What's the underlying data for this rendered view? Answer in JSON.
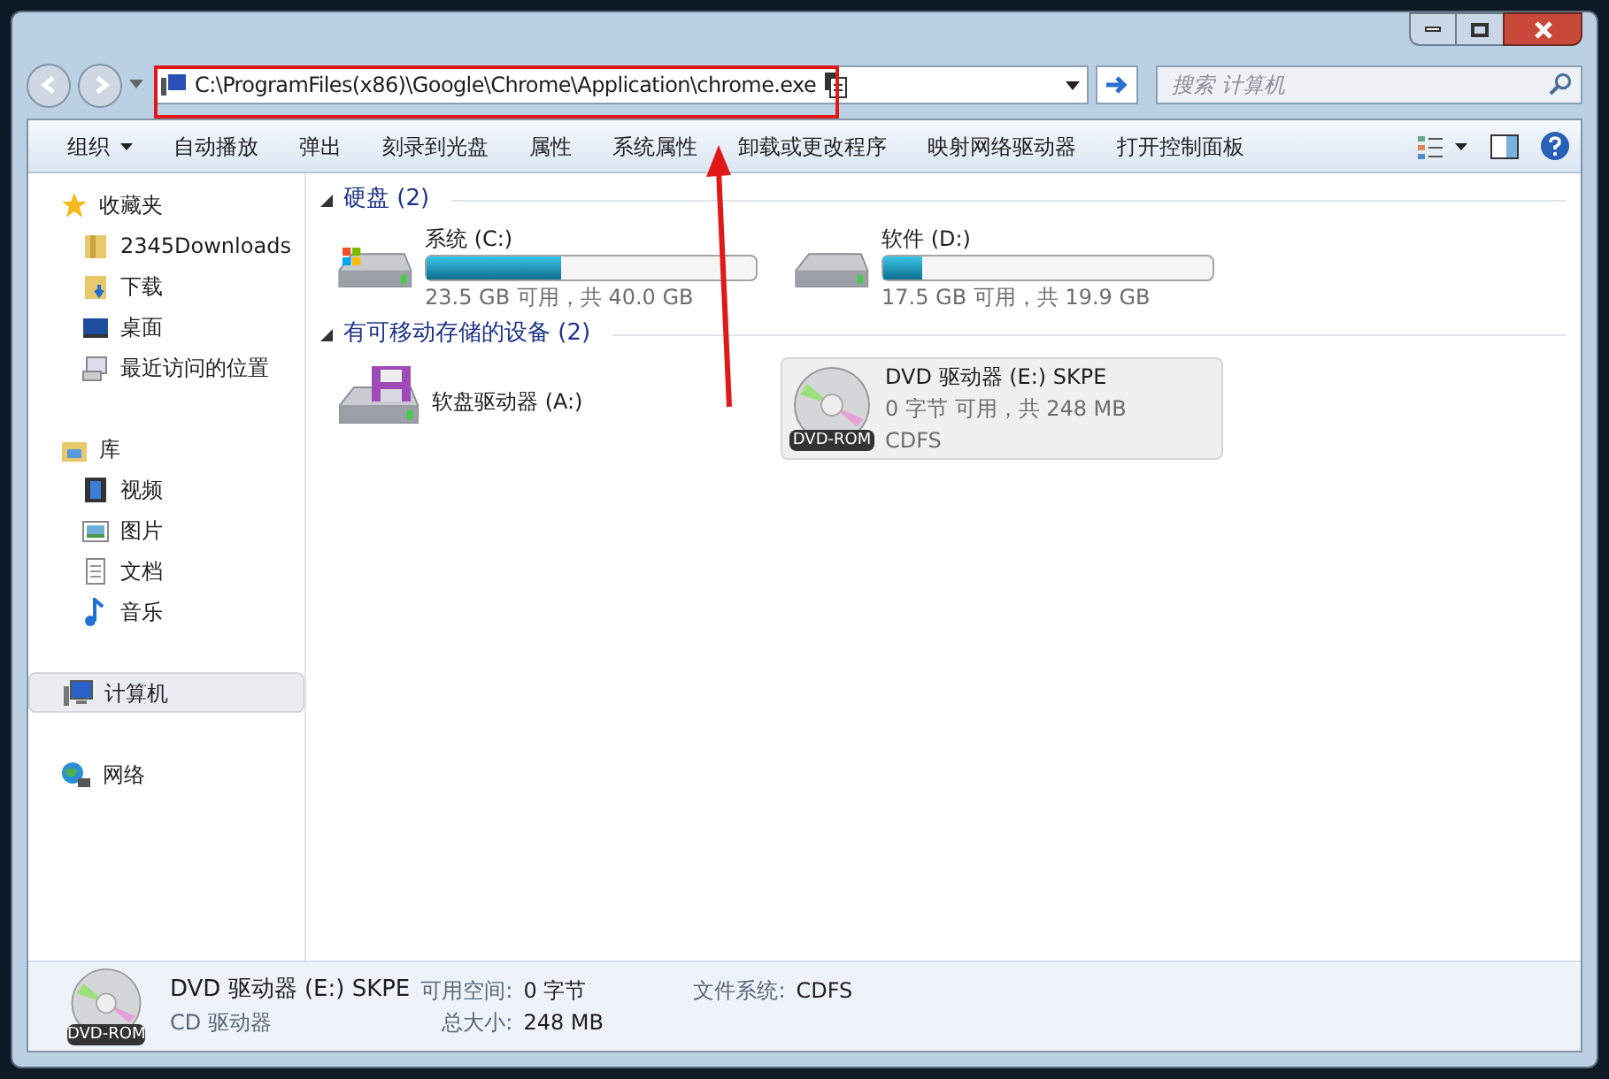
{
  "window": {
    "address": "C:\\ProgramFiles(x86)\\Google\\Chrome\\Application\\chrome.exe",
    "search": {
      "placeholder": "搜索 计算机"
    }
  },
  "toolbar": [
    {
      "label": "组织",
      "dropdown": true
    },
    {
      "label": "自动播放",
      "dropdown": false
    },
    {
      "label": "弹出",
      "dropdown": false
    },
    {
      "label": "刻录到光盘",
      "dropdown": false
    },
    {
      "label": "属性",
      "dropdown": false
    },
    {
      "label": "系统属性",
      "dropdown": false
    },
    {
      "label": "卸载或更改程序",
      "dropdown": false
    },
    {
      "label": "映射网络驱动器",
      "dropdown": false
    },
    {
      "label": "打开控制面板",
      "dropdown": false
    }
  ],
  "sidebar": {
    "items": [
      {
        "label": "收藏夹",
        "selected": false,
        "children": [
          {
            "label": "2345Downloads",
            "selected": false
          },
          {
            "label": "下载",
            "selected": false
          },
          {
            "label": "桌面",
            "selected": false
          },
          {
            "label": "最近访问的位置",
            "selected": false
          }
        ]
      },
      {
        "label": "库",
        "selected": false,
        "children": [
          {
            "label": "视频",
            "selected": false
          },
          {
            "label": "图片",
            "selected": false
          },
          {
            "label": "文档",
            "selected": false
          },
          {
            "label": "音乐",
            "selected": false
          }
        ]
      },
      {
        "label": "计算机",
        "selected": true
      },
      {
        "label": "网络",
        "selected": false
      }
    ]
  },
  "groups": [
    {
      "title": "硬盘 (2)",
      "drives": [
        {
          "kind": "hdd",
          "name": "系统 (C:)",
          "level": 0.41,
          "info": "23.5 GB 可用，共 40.0 GB",
          "windows": true,
          "selected": false
        },
        {
          "kind": "hdd",
          "name": "软件 (D:)",
          "level": 0.12,
          "info": "17.5 GB 可用，共 19.9 GB",
          "windows": false,
          "selected": false
        }
      ]
    },
    {
      "title": "有可移动存储的设备 (2)",
      "drives": [
        {
          "kind": "floppy",
          "name": "软盘驱动器 (A:)",
          "selected": false
        },
        {
          "kind": "dvd",
          "name": "DVD 驱动器 (E:) SKPE",
          "info": "0 字节 可用，共 248 MB",
          "fs": "CDFS",
          "disc_label": "DVD-ROM",
          "selected": true
        }
      ]
    }
  ],
  "details": {
    "disc_label": "DVD-ROM",
    "name": "DVD 驱动器 (E:) SKPE",
    "type": "CD 驱动器",
    "fields": [
      {
        "label": "可用空间:",
        "value": "0 字节"
      },
      {
        "label": "总大小:",
        "value": "248 MB"
      },
      {
        "label": "文件系统:",
        "value": "CDFS"
      }
    ]
  }
}
